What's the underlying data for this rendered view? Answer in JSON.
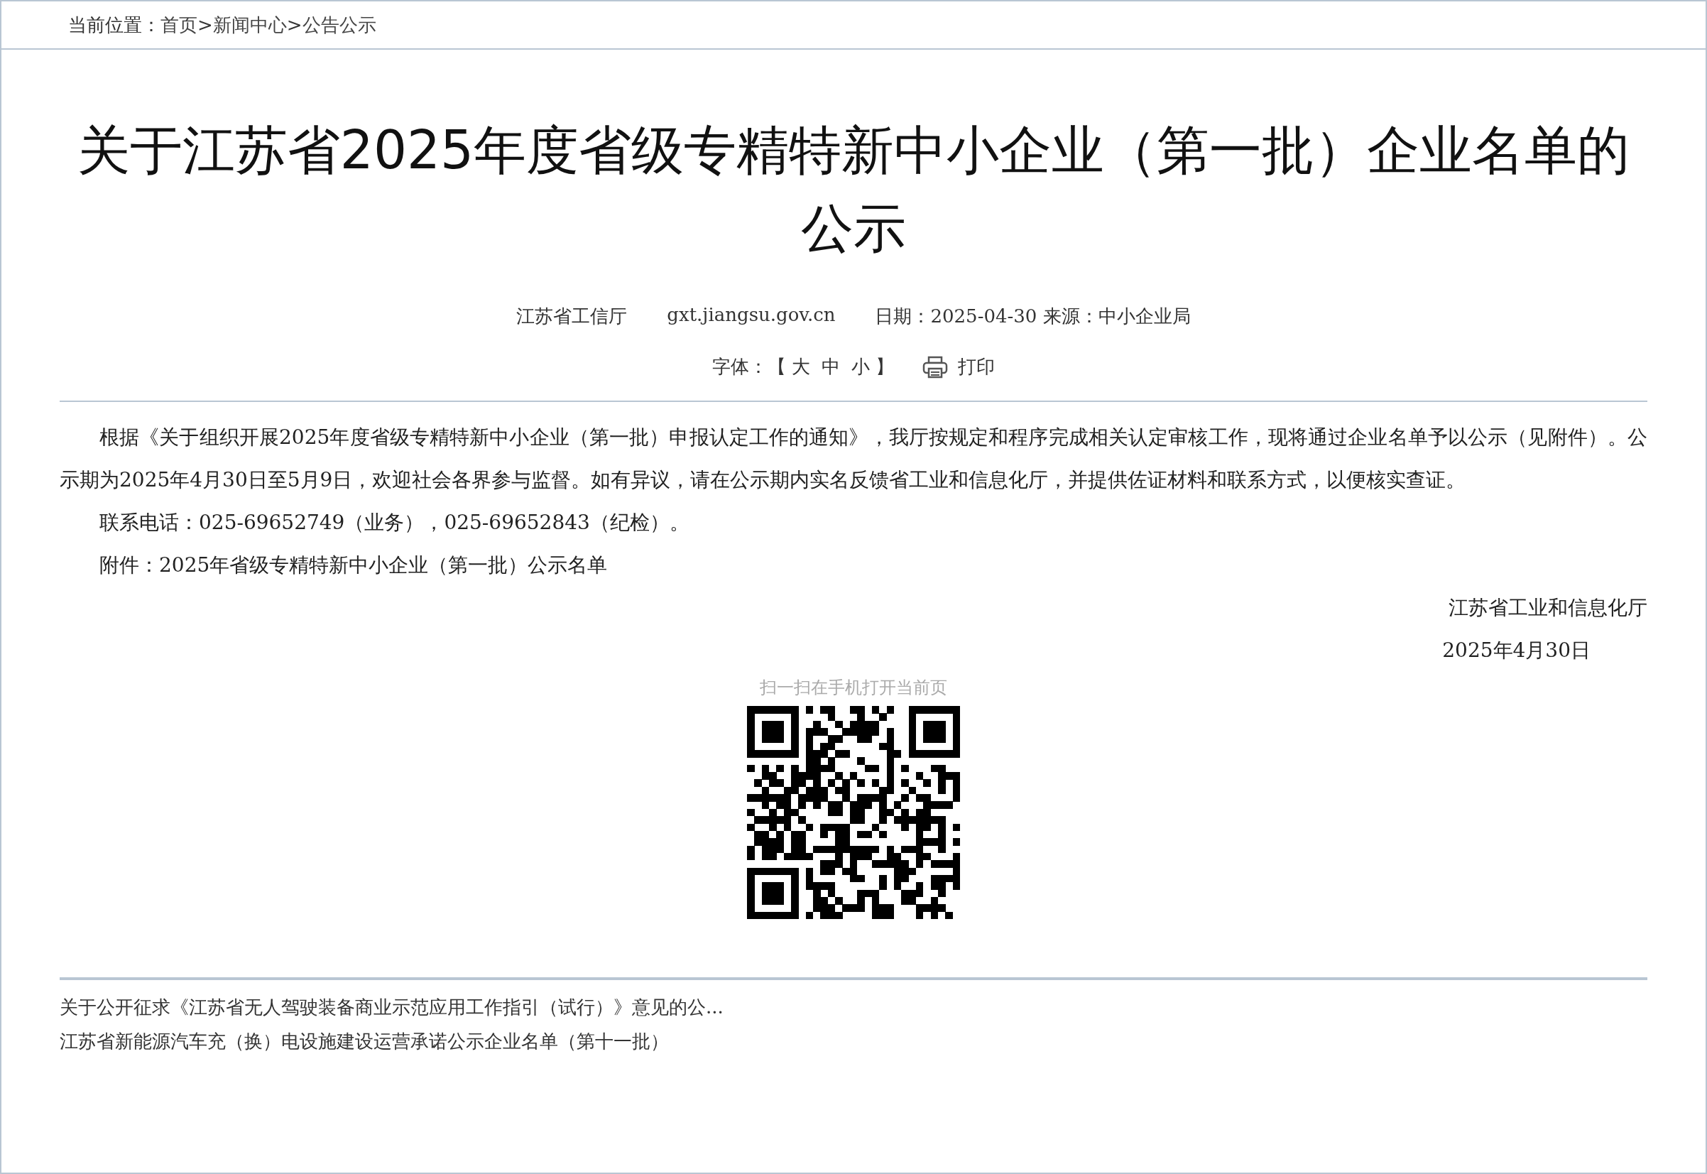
{
  "breadcrumb": {
    "label": "当前位置：",
    "items": [
      "首页",
      "新闻中心",
      "公告公示"
    ],
    "separators": [
      ">",
      ">"
    ]
  },
  "article": {
    "title": "关于江苏省2025年度省级专精特新中小企业（第一批）企业名单的公示",
    "meta": [
      "江苏省工信厅",
      "gxt.jiangsu.gov.cn",
      "日期：2025-04-30 来源：中小企业局"
    ],
    "font_size": {
      "label": "字体：",
      "open": "【",
      "options": [
        "大",
        "中",
        "小"
      ],
      "close": "】"
    },
    "print": "打印",
    "paragraphs": [
      "根据《关于组织开展2025年度省级专精特新中小企业（第一批）申报认定工作的通知》，我厅按规定和程序完成相关认定审核工作，现将通过企业名单予以公示（见附件）。公示期为2025年4月30日至5月9日，欢迎社会各界参与监督。如有异议，请在公示期内实名反馈省工业和信息化厅，并提供佐证材料和联系方式，以便核实查证。",
      "联系电话：025-69652749（业务），025-69652843（纪检）。"
    ],
    "attachment": "附件：2025年省级专精特新中小企业（第一批）公示名单",
    "signature": "江苏省工业和信息化厅",
    "sign_date": "2025年4月30日",
    "qr_caption": "扫一扫在手机打开当前页"
  },
  "related_links": [
    "关于公开征求《江苏省无人驾驶装备商业示范应用工作指引（试行）》意见的公...",
    "江苏省新能源汽车充（换）电设施建设运营承诺公示企业名单（第十一批）"
  ]
}
